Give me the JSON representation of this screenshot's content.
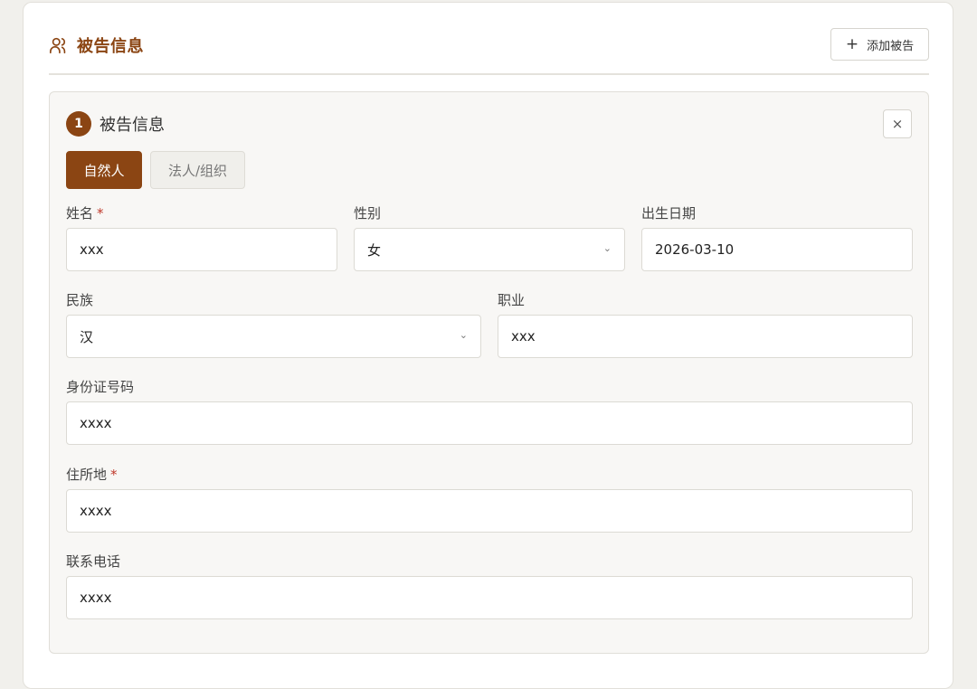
{
  "section": {
    "title": "被告信息",
    "add_button": "添加被告"
  },
  "defendant_card": {
    "number": "1",
    "title": "被告信息",
    "close_symbol": "×",
    "type_tabs": [
      {
        "label": "自然人",
        "active": true
      },
      {
        "label": "法人/组织",
        "active": false
      }
    ],
    "fields": {
      "name": {
        "label": "姓名",
        "required_mark": "*",
        "value": "xxx"
      },
      "gender": {
        "label": "性别",
        "value": "女"
      },
      "birth_date": {
        "label": "出生日期",
        "value": "2026-03-10"
      },
      "ethnicity": {
        "label": "民族",
        "value": "汉"
      },
      "occupation": {
        "label": "职业",
        "value": "xxx"
      },
      "id_number": {
        "label": "身份证号码",
        "value": "xxxx"
      },
      "address": {
        "label": "住所地",
        "required_mark": "*",
        "value": "xxxx"
      },
      "phone": {
        "label": "联系电话",
        "value": "xxxx"
      }
    }
  },
  "colors": {
    "accent": "#8b4513",
    "required": "#c0392b",
    "background": "#f1f0ec"
  },
  "icons": {
    "section_icon": "users-icon",
    "add_icon": "plus-icon",
    "close_icon": "close-icon",
    "select_icon": "chevron-down-icon"
  }
}
